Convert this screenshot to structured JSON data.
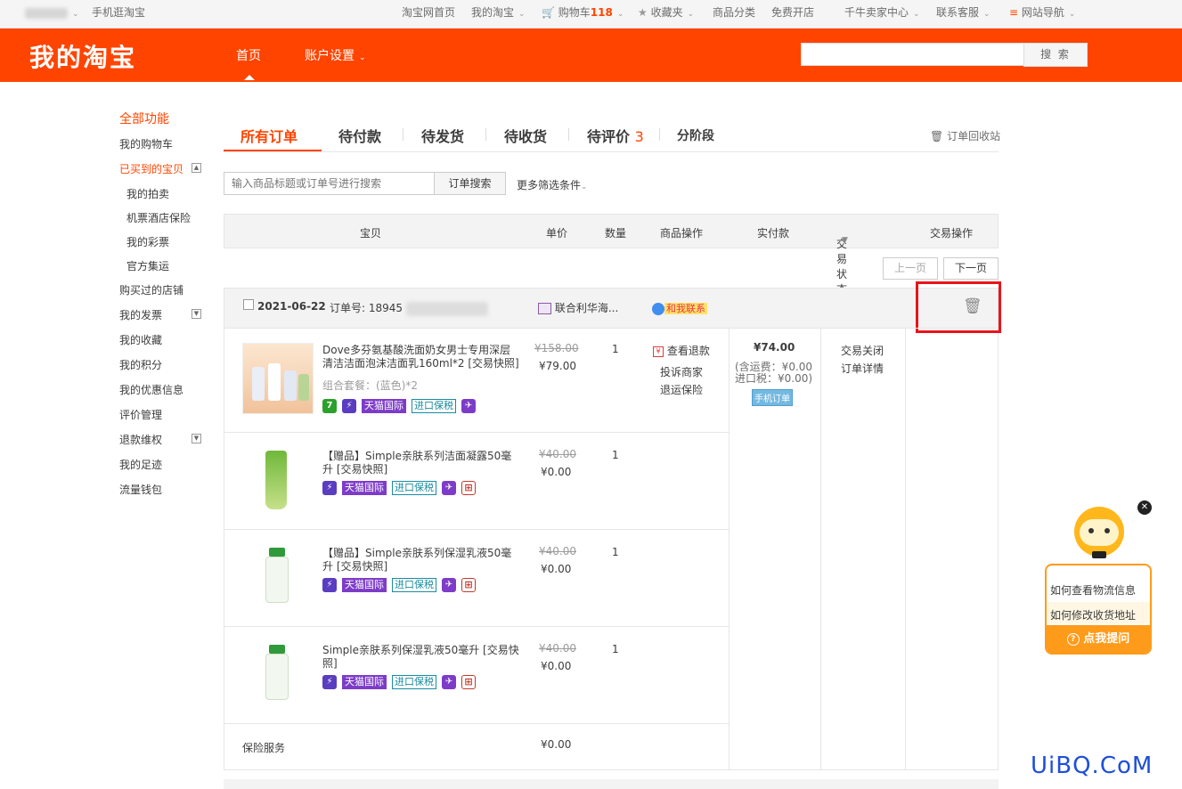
{
  "topbar": {
    "user_blurred": "",
    "mobile": "手机逛淘宝",
    "taobao_home": "淘宝网首页",
    "my_taobao": "我的淘宝",
    "cart_label": "购物车",
    "cart_count": "118",
    "favorites": "收藏夹",
    "categories": "商品分类",
    "free_shop": "免费开店",
    "seller_center": "千牛卖家中心",
    "contact": "联系客服",
    "site_nav": "网站导航"
  },
  "header": {
    "logo": "我的淘宝",
    "nav_home": "首页",
    "nav_account": "账户设置",
    "search_placeholder": "",
    "search_button": "搜 索"
  },
  "sidebar": {
    "title": "全部功能",
    "items": [
      "我的购物车",
      "已买到的宝贝",
      "我的拍卖",
      "机票酒店保险",
      "我的彩票",
      "官方集运",
      "购买过的店铺",
      "我的发票",
      "我的收藏",
      "我的积分",
      "我的优惠信息",
      "评价管理",
      "退款维权",
      "我的足迹",
      "流量钱包"
    ]
  },
  "tabs": {
    "all": "所有订单",
    "pay": "待付款",
    "ship": "待发货",
    "receive": "待收货",
    "review": "待评价",
    "review_count": "3",
    "stage": "分阶段",
    "recycle": "订单回收站"
  },
  "search": {
    "placeholder": "输入商品标题或订单号进行搜索",
    "button": "订单搜索",
    "more_filters": "更多筛选条件"
  },
  "table_header": {
    "item": "宝贝",
    "price": "单价",
    "qty": "数量",
    "ops": "商品操作",
    "paid": "实付款",
    "status": "交易状态",
    "actions": "交易操作"
  },
  "pager": {
    "prev": "上一页",
    "next": "下一页"
  },
  "order": {
    "date": "2021-06-22",
    "order_no_label": "订单号: 18945",
    "shop": "联合利华海...",
    "contact": "和我联系",
    "products": [
      {
        "title": "Dove多芬氨基酸洗面奶女男士专用深层清洁洁面泡沫洁面乳160ml*2 [交易快照]",
        "sub": "组合套餐：(蓝色)*2",
        "old_price": "¥158.00",
        "price": "¥79.00",
        "qty": "1"
      },
      {
        "title": "【赠品】Simple亲肤系列洁面凝露50毫升 [交易快照]",
        "old_price": "¥40.00",
        "price": "¥0.00",
        "qty": "1"
      },
      {
        "title": "【赠品】Simple亲肤系列保湿乳液50毫升 [交易快照]",
        "old_price": "¥40.00",
        "price": "¥0.00",
        "qty": "1"
      },
      {
        "title": "Simple亲肤系列保湿乳液50毫升 [交易快照]",
        "old_price": "¥40.00",
        "price": "¥0.00",
        "qty": "1"
      }
    ],
    "ops": {
      "refund": "查看退款",
      "complain": "投诉商家",
      "return_insurance": "退运保险"
    },
    "paid": {
      "total": "¥74.00",
      "shipping": "(含运费：¥0.00",
      "tax": "进口税：¥0.00)",
      "mobile_badge": "手机订单"
    },
    "status": {
      "closed": "交易关闭",
      "detail": "订单详情"
    },
    "tags": {
      "tmall": "天猫国际",
      "bonded": "进口保税",
      "seven": "7"
    },
    "insurance": {
      "label": "保险服务",
      "price": "¥0.00"
    }
  },
  "helper": {
    "q1": "如何查看物流信息",
    "q2": "如何修改收货地址",
    "ask": "点我提问"
  },
  "watermark": "UiBQ.CoM"
}
